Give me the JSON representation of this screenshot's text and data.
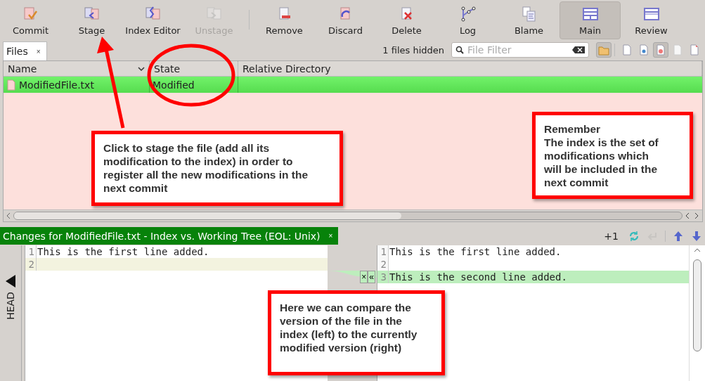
{
  "toolbar": {
    "buttons": [
      {
        "label": "Commit",
        "disabled": false,
        "selected": false
      },
      {
        "label": "Stage",
        "disabled": false,
        "selected": false
      },
      {
        "label": "Index Editor",
        "disabled": false,
        "selected": false
      },
      {
        "label": "Unstage",
        "disabled": true,
        "selected": false
      },
      {
        "label": "Remove",
        "disabled": false,
        "selected": false
      },
      {
        "label": "Discard",
        "disabled": false,
        "selected": false
      },
      {
        "label": "Delete",
        "disabled": false,
        "selected": false
      },
      {
        "label": "Log",
        "disabled": false,
        "selected": false
      },
      {
        "label": "Blame",
        "disabled": false,
        "selected": false
      },
      {
        "label": "Main",
        "disabled": false,
        "selected": true
      },
      {
        "label": "Review",
        "disabled": false,
        "selected": false
      }
    ]
  },
  "files_panel": {
    "tab": {
      "label": "Files",
      "close": "×"
    },
    "files_hidden": "1 files hidden",
    "filter": {
      "placeholder": "File Filter"
    },
    "view_toggles": [
      {
        "on": true
      },
      {
        "on": false
      },
      {
        "on": false
      },
      {
        "on": true
      },
      {
        "on": false
      },
      {
        "on": false
      }
    ],
    "table": {
      "columns": [
        "Name",
        "State",
        "Relative Directory"
      ],
      "rows": [
        {
          "name": "ModifiedFile.txt",
          "state": "Modified",
          "selected": true
        }
      ]
    }
  },
  "diff_panel": {
    "tab": {
      "label": "Changes for ModifiedFile.txt - Index vs. Working Tree (EOL: Unix)",
      "close": "×"
    },
    "change_count": "+1",
    "side_label": "HEAD",
    "left_lines": [
      {
        "number": "1",
        "text": "This is the first line added.",
        "kind": "normal"
      },
      {
        "number": "2",
        "kind": "gap"
      }
    ],
    "right_lines": [
      {
        "number": "1",
        "text": "This is the first line added.",
        "kind": "normal"
      },
      {
        "number": "2",
        "kind": "normal"
      },
      {
        "number": "3",
        "text": "This is the second line added.",
        "kind": "added"
      }
    ],
    "chunk_actions": [
      "×",
      "«"
    ]
  },
  "annotations": [
    {
      "kind": "callout",
      "text": "Click to stage the file (add all its modification to the index) in order to register all the new modifications in the next commit"
    },
    {
      "kind": "callout",
      "title": "Remember",
      "text": "The index is the set of modifications which will be included in the next commit"
    },
    {
      "kind": "callout",
      "text": "Here we can compare the version of the file in the index (left) to the currently modified version (right)"
    }
  ]
}
